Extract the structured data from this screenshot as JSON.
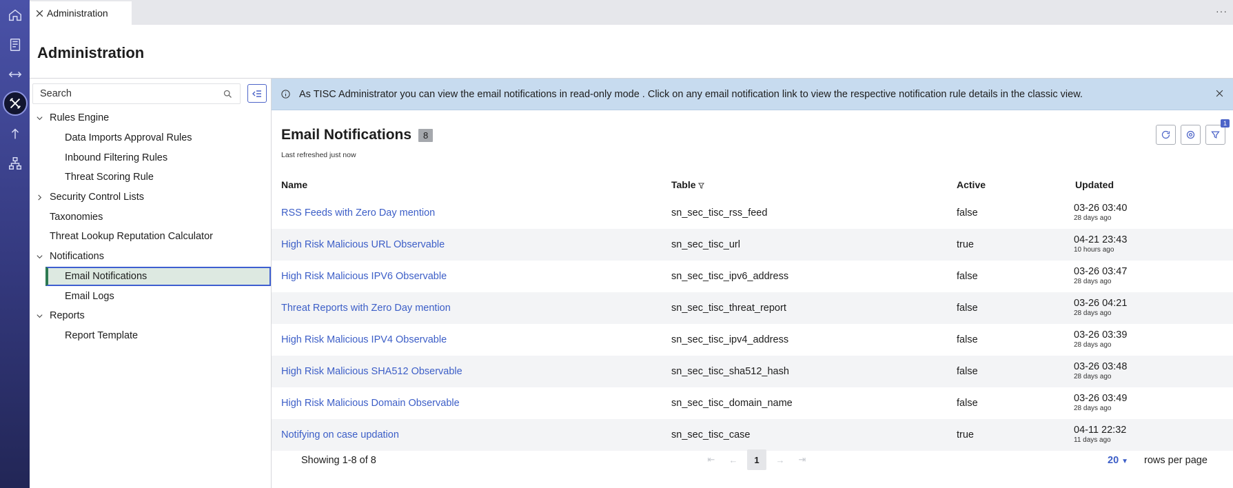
{
  "rail": {
    "icons": [
      "home-icon",
      "book-icon",
      "transfer-icon",
      "admin-tools-icon",
      "upload-icon",
      "hierarchy-icon"
    ]
  },
  "tab": {
    "label": "Administration"
  },
  "page": {
    "title": "Administration"
  },
  "search": {
    "placeholder": "Search"
  },
  "tree": [
    {
      "label": "Rules Engine",
      "level": 1,
      "chevron": "down"
    },
    {
      "label": "Data Imports Approval Rules",
      "level": 2
    },
    {
      "label": "Inbound Filtering Rules",
      "level": 2
    },
    {
      "label": "Threat Scoring Rule",
      "level": 2
    },
    {
      "label": "Security Control Lists",
      "level": 1,
      "chevron": "right"
    },
    {
      "label": "Taxonomies",
      "level": 1
    },
    {
      "label": "Threat Lookup Reputation Calculator",
      "level": 1
    },
    {
      "label": "Notifications",
      "level": 1,
      "chevron": "down"
    },
    {
      "label": "Email Notifications",
      "level": 2,
      "selected": true
    },
    {
      "label": "Email Logs",
      "level": 2
    },
    {
      "label": "Reports",
      "level": 1,
      "chevron": "down"
    },
    {
      "label": "Report Template",
      "level": 2
    }
  ],
  "banner": {
    "text": "As TISC Administrator you can view the email notifications in read-only mode . Click on any email notification link to view the respective notification rule details in the classic view."
  },
  "list": {
    "title": "Email Notifications",
    "count": "8",
    "refreshed": "Last refreshed just now",
    "filter_badge": "1"
  },
  "columns": {
    "name": "Name",
    "table": "Table",
    "active": "Active",
    "updated": "Updated"
  },
  "rows": [
    {
      "name": "RSS Feeds with Zero Day mention",
      "table": "sn_sec_tisc_rss_feed",
      "active": "false",
      "updated": "03-26 03:40",
      "ago": "28 days ago"
    },
    {
      "name": "High Risk Malicious URL Observable",
      "table": "sn_sec_tisc_url",
      "active": "true",
      "updated": "04-21 23:43",
      "ago": "10 hours ago"
    },
    {
      "name": "High Risk Malicious IPV6 Observable",
      "table": "sn_sec_tisc_ipv6_address",
      "active": "false",
      "updated": "03-26 03:47",
      "ago": "28 days ago"
    },
    {
      "name": "Threat Reports with Zero Day mention",
      "table": "sn_sec_tisc_threat_report",
      "active": "false",
      "updated": "03-26 04:21",
      "ago": "28 days ago"
    },
    {
      "name": "High Risk Malicious IPV4 Observable",
      "table": "sn_sec_tisc_ipv4_address",
      "active": "false",
      "updated": "03-26 03:39",
      "ago": "28 days ago"
    },
    {
      "name": "High Risk Malicious SHA512  Observable",
      "table": "sn_sec_tisc_sha512_hash",
      "active": "false",
      "updated": "03-26 03:48",
      "ago": "28 days ago"
    },
    {
      "name": "High Risk Malicious Domain Observable",
      "table": "sn_sec_tisc_domain_name",
      "active": "false",
      "updated": "03-26 03:49",
      "ago": "28 days ago"
    },
    {
      "name": "Notifying on case updation",
      "table": "sn_sec_tisc_case",
      "active": "true",
      "updated": "04-11 22:32",
      "ago": "11 days ago"
    }
  ],
  "footer": {
    "showing": "Showing 1-8 of 8",
    "current_page": "1",
    "rows_per_page_value": "20",
    "rows_per_page_label": "rows per page"
  }
}
